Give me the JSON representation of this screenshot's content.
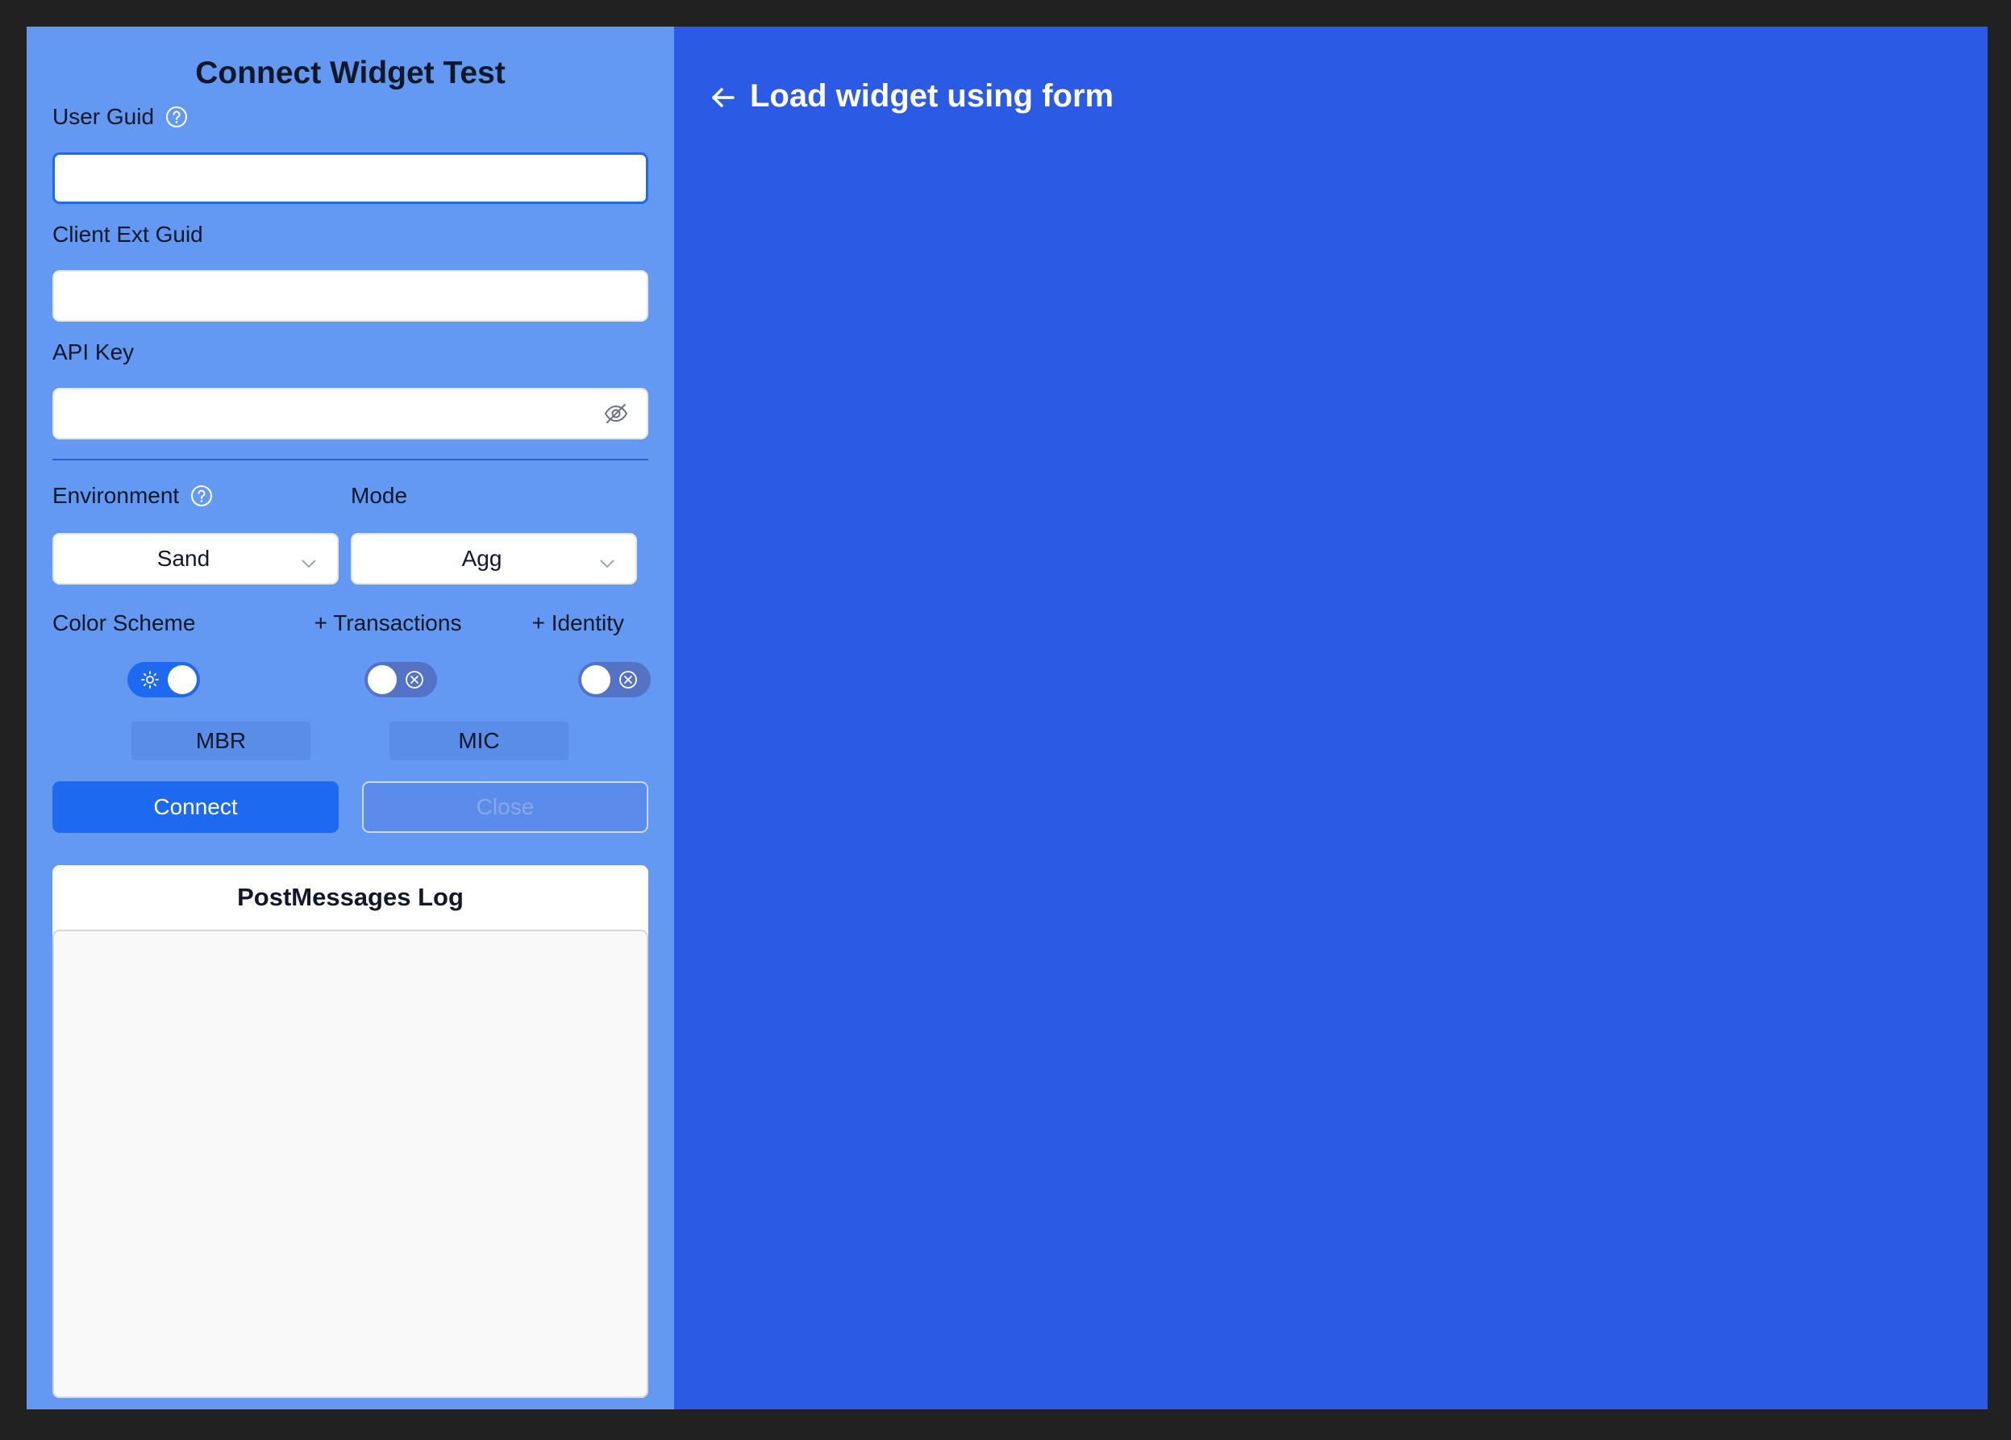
{
  "form": {
    "title": "Connect Widget Test",
    "user_guid": {
      "label": "User Guid",
      "value": "",
      "help_icon": "question-circle-icon"
    },
    "client_ext_guid": {
      "label": "Client Ext Guid",
      "value": ""
    },
    "api_key": {
      "label": "API Key",
      "value": "",
      "visibility_icon": "eye-slash-icon"
    },
    "environment": {
      "label": "Environment",
      "selected": "Sand",
      "help_icon": "question-circle-icon"
    },
    "mode": {
      "label": "Mode",
      "selected": "Agg"
    },
    "color_scheme": {
      "label": "Color Scheme",
      "on": true,
      "icon": "sun-icon"
    },
    "transactions": {
      "label": "+ Transactions",
      "on": false,
      "icon": "x-circle-icon"
    },
    "identity": {
      "label": "+ Identity",
      "on": false,
      "icon": "x-circle-icon"
    },
    "tabs": [
      {
        "label": "MBR"
      },
      {
        "label": "MIC"
      }
    ],
    "connect_label": "Connect",
    "close_label": "Close"
  },
  "log": {
    "title": "PostMessages Log",
    "entries": []
  },
  "content": {
    "back_link": "Load widget using form",
    "back_icon": "arrow-left-icon"
  },
  "colors": {
    "accent": "#1d6af0",
    "left_panel": "#6399f3",
    "right_panel": "#2b5ae4",
    "frame_background": "#212121"
  }
}
